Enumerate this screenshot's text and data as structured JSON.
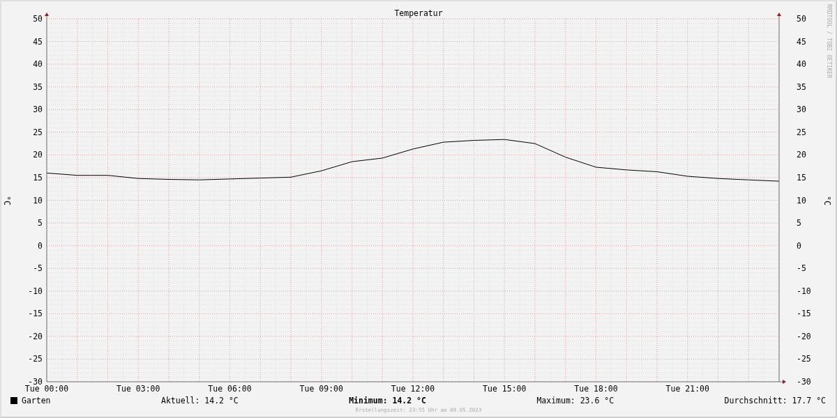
{
  "graph": {
    "credit": "RRDTOOL / TOBI OETIKER",
    "right_axis_label": "°C",
    "right_ticks": [
      "50",
      "45",
      "40",
      "35",
      "30",
      "25",
      "20",
      "15",
      "10",
      "5",
      "0",
      "-5",
      "-10",
      "-15",
      "-20",
      "-25",
      "-30"
    ],
    "chart_data": {
      "type": "line",
      "title": "Temperatur",
      "ylabel": "°C",
      "categories": [
        "Tue 00:00",
        null,
        null,
        "Tue 03:00",
        null,
        null,
        "Tue 06:00",
        null,
        null,
        "Tue 09:00",
        null,
        null,
        "Tue 12:00",
        null,
        null,
        "Tue 15:00",
        null,
        null,
        "Tue 18:00",
        null,
        null,
        "Tue 21:00",
        null,
        null,
        null
      ],
      "series": [
        {
          "name": "Garten",
          "color": "#000000",
          "values": [
            16.0,
            15.5,
            15.5,
            14.8,
            14.6,
            14.5,
            14.7,
            14.9,
            15.1,
            16.5,
            18.5,
            19.3,
            21.3,
            22.8,
            23.2,
            23.4,
            22.5,
            19.5,
            17.3,
            16.7,
            16.3,
            15.3,
            14.8,
            14.5,
            14.2
          ]
        }
      ],
      "ylim": [
        -30,
        50
      ],
      "grid": true,
      "yticks": [
        -30,
        -25,
        -20,
        -15,
        -10,
        -5,
        0,
        5,
        10,
        15,
        20,
        25,
        30,
        35,
        40,
        45,
        50
      ]
    }
  },
  "legend": {
    "stats": [
      {
        "label": "Aktuell:",
        "value": "14.2 °C",
        "bold": false
      },
      {
        "label": "Minimum:",
        "value": "14.2 °C",
        "bold": true
      },
      {
        "label": "Maximum:",
        "value": "23.6 °C",
        "bold": false
      },
      {
        "label": "Durchschnitt:",
        "value": "17.7 °C",
        "bold": false
      }
    ]
  },
  "footer": "Erstellungszeit: 23:55 Uhr am 09.05.2023"
}
